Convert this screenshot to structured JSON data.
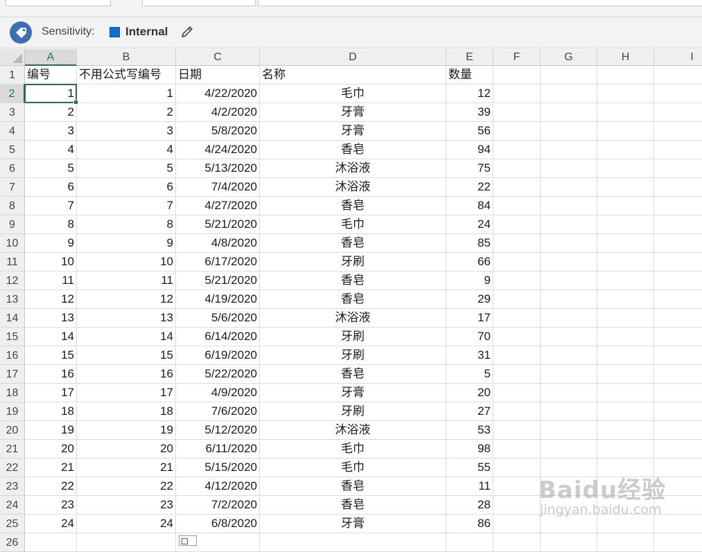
{
  "sensitivity": {
    "label": "Sensitivity:",
    "value": "Internal",
    "color": "#0f6fd1"
  },
  "columns": [
    "A",
    "B",
    "C",
    "D",
    "E",
    "F",
    "G",
    "H",
    "I"
  ],
  "selected_cell": "A2",
  "header_row": [
    "编号",
    "不用公式写编号",
    "日期",
    "名称",
    "数量"
  ],
  "rows": [
    [
      "1",
      "1",
      "4/22/2020",
      "毛巾",
      "12"
    ],
    [
      "2",
      "2",
      "4/2/2020",
      "牙膏",
      "39"
    ],
    [
      "3",
      "3",
      "5/8/2020",
      "牙膏",
      "56"
    ],
    [
      "4",
      "4",
      "4/24/2020",
      "香皂",
      "94"
    ],
    [
      "5",
      "5",
      "5/13/2020",
      "沐浴液",
      "75"
    ],
    [
      "6",
      "6",
      "7/4/2020",
      "沐浴液",
      "22"
    ],
    [
      "7",
      "7",
      "4/27/2020",
      "香皂",
      "84"
    ],
    [
      "8",
      "8",
      "5/21/2020",
      "毛巾",
      "24"
    ],
    [
      "9",
      "9",
      "4/8/2020",
      "香皂",
      "85"
    ],
    [
      "10",
      "10",
      "6/17/2020",
      "牙刷",
      "66"
    ],
    [
      "11",
      "11",
      "5/21/2020",
      "香皂",
      "9"
    ],
    [
      "12",
      "12",
      "4/19/2020",
      "香皂",
      "29"
    ],
    [
      "13",
      "13",
      "5/6/2020",
      "沐浴液",
      "17"
    ],
    [
      "14",
      "14",
      "6/14/2020",
      "牙刷",
      "70"
    ],
    [
      "15",
      "15",
      "6/19/2020",
      "牙刷",
      "31"
    ],
    [
      "16",
      "16",
      "5/22/2020",
      "香皂",
      "5"
    ],
    [
      "17",
      "17",
      "4/9/2020",
      "牙膏",
      "20"
    ],
    [
      "18",
      "18",
      "7/6/2020",
      "牙刷",
      "27"
    ],
    [
      "19",
      "19",
      "5/12/2020",
      "沐浴液",
      "53"
    ],
    [
      "20",
      "20",
      "6/11/2020",
      "毛巾",
      "98"
    ],
    [
      "21",
      "21",
      "5/15/2020",
      "毛巾",
      "55"
    ],
    [
      "22",
      "22",
      "4/12/2020",
      "香皂",
      "11"
    ],
    [
      "23",
      "23",
      "7/2/2020",
      "香皂",
      "28"
    ],
    [
      "24",
      "24",
      "6/8/2020",
      "牙膏",
      "86"
    ]
  ],
  "row_numbers": [
    "1",
    "2",
    "3",
    "4",
    "5",
    "6",
    "7",
    "8",
    "9",
    "10",
    "11",
    "12",
    "13",
    "14",
    "15",
    "16",
    "17",
    "18",
    "19",
    "20",
    "21",
    "22",
    "23",
    "24",
    "25",
    "26"
  ],
  "icons": {
    "sensitivity": "tag-icon",
    "edit": "pencil-icon",
    "quick_analysis": "quick-analysis-icon"
  },
  "watermark": {
    "line1": "Baidu经验",
    "line2": "jingyan.baidu.com"
  }
}
